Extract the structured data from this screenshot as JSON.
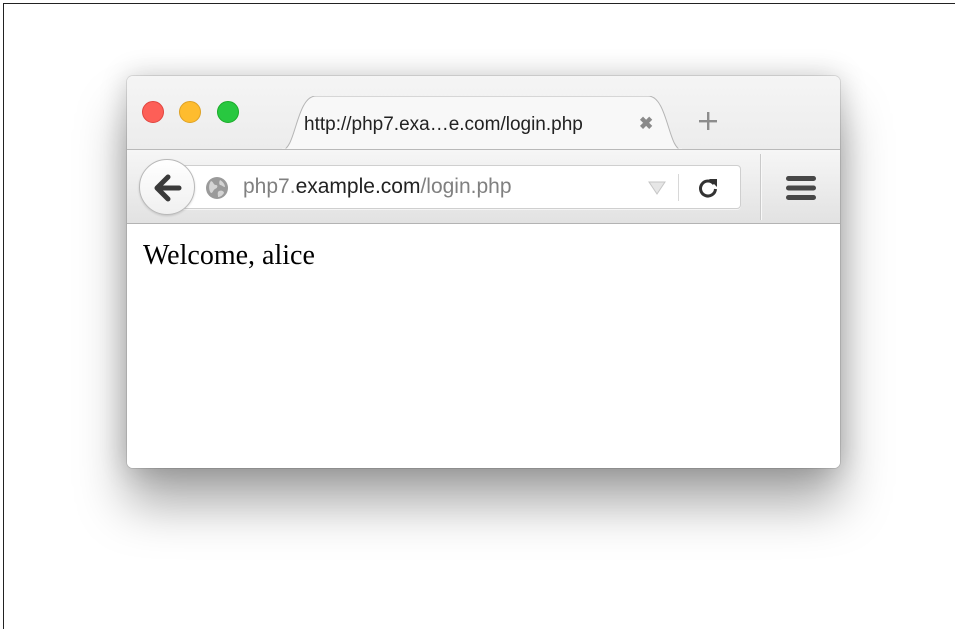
{
  "window": {
    "traffic_lights": {
      "close_color": "#fd5f57",
      "minimize_color": "#febc2e",
      "maximize_color": "#28c840"
    }
  },
  "tab": {
    "title": "http://php7.exa…e.com/login.php",
    "close_glyph": "✖"
  },
  "new_tab_icon": "plus-icon",
  "navbar": {
    "back_icon": "arrow-left-icon",
    "site_icon": "globe-icon",
    "url": {
      "prefix": "php7.",
      "domain": "example.com",
      "path": "/login.php"
    },
    "dropdown_icon": "triangle-down-icon",
    "reload_icon": "reload-icon",
    "menu_icon": "hamburger-menu-icon"
  },
  "content": {
    "text": "Welcome, alice"
  }
}
